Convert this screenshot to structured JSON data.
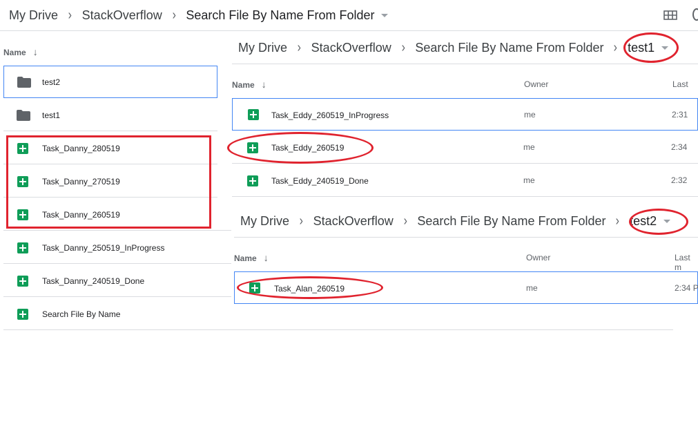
{
  "panel_main": {
    "breadcrumb": [
      "My Drive",
      "StackOverflow",
      "Search File By Name From Folder"
    ],
    "header_name": "Name",
    "rows": [
      {
        "name": "test2",
        "type": "folder"
      },
      {
        "name": "test1",
        "type": "folder"
      },
      {
        "name": "Task_Danny_280519",
        "type": "sheet"
      },
      {
        "name": "Task_Danny_270519",
        "type": "sheet"
      },
      {
        "name": "Task_Danny_260519",
        "type": "sheet"
      },
      {
        "name": "Task_Danny_250519_InProgress",
        "type": "sheet"
      },
      {
        "name": "Task_Danny_240519_Done",
        "type": "sheet"
      },
      {
        "name": "Search File By Name",
        "type": "sheet"
      }
    ]
  },
  "panel_test1": {
    "breadcrumb": [
      "My Drive",
      "StackOverflow",
      "Search File By Name From Folder",
      "test1"
    ],
    "headers": {
      "name": "Name",
      "owner": "Owner",
      "last": "Last"
    },
    "rows": [
      {
        "name": "Task_Eddy_260519_InProgress",
        "owner": "me",
        "last": "2:31"
      },
      {
        "name": "Task_Eddy_260519",
        "owner": "me",
        "last": "2:34"
      },
      {
        "name": "Task_Eddy_240519_Done",
        "owner": "me",
        "last": "2:32"
      }
    ]
  },
  "panel_test2": {
    "breadcrumb": [
      "My Drive",
      "StackOverflow",
      "Search File By Name From Folder",
      "test2"
    ],
    "headers": {
      "name": "Name",
      "owner": "Owner",
      "last": "Last m"
    },
    "rows": [
      {
        "name": "Task_Alan_260519",
        "owner": "me",
        "last": "2:34 P"
      }
    ]
  },
  "icons": {
    "view": "grid-view-icon",
    "sheet": "google-sheets-icon",
    "folder": "folder-icon"
  },
  "colors": {
    "sheet_green": "#0f9d58",
    "annotation_red": "#e0232e",
    "selection_blue": "#4285f4"
  }
}
